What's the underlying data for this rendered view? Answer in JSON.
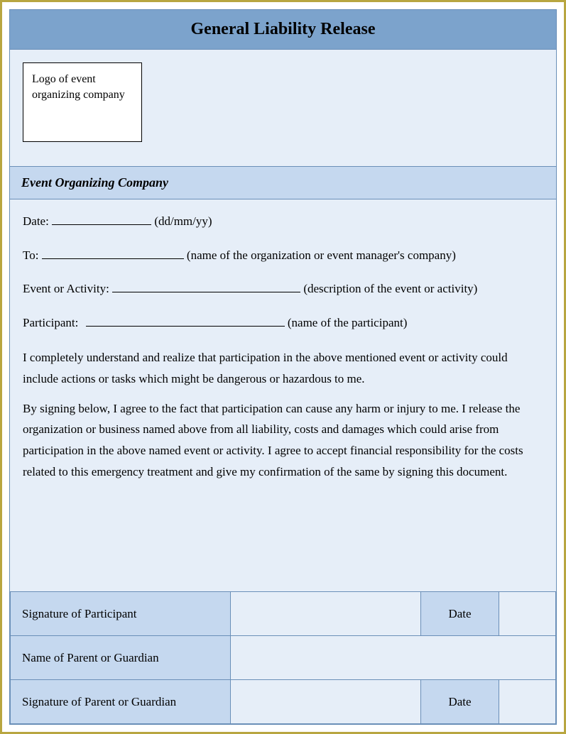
{
  "title": "General Liability Release",
  "logo_placeholder": "Logo of event organizing company",
  "subtitle": "Event Organizing Company",
  "fields": {
    "date_label": "Date:",
    "date_hint": "(dd/mm/yy)",
    "to_label": "To:",
    "to_hint": "(name of the organization or event manager's company)",
    "event_label": "Event or Activity:",
    "event_hint": "(description of the event or activity)",
    "participant_label": "Participant:",
    "participant_hint": "(name of the participant)"
  },
  "paragraph1": "I completely understand and realize that participation in the above mentioned event or activity could include actions or tasks which might be dangerous or hazardous to me.",
  "paragraph2": "By signing below, I agree to the fact that participation can cause any harm or injury to me. I release the organization or business named above from all liability, costs and damages which could arise from participation in the above named event or activity.  I agree to accept financial responsibility for the costs related to this emergency treatment and give my confirmation of the same by signing this document.",
  "signatures": {
    "participant_sig": "Signature of Participant",
    "guardian_name": "Name of Parent or Guardian",
    "guardian_sig": "Signature of Parent or Guardian",
    "date_label": "Date"
  }
}
